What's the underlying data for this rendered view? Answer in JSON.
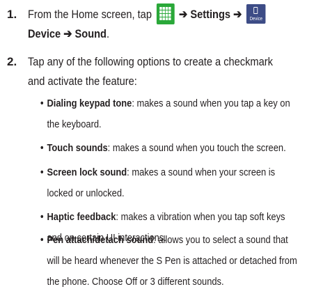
{
  "steps": [
    {
      "number": "1.",
      "pre": "From the Home screen, tap",
      "arrow1": " ➔ ",
      "settings": "Settings",
      "arrow2": " ➔ ",
      "device_icon_label": "Device",
      "line2": "Device ➔ Sound",
      "line2_end": "."
    },
    {
      "number": "2.",
      "line1": "Tap any of the following options to create a checkmark",
      "line2": "and activate the feature:"
    }
  ],
  "options": [
    {
      "term": "Dialing keypad tone",
      "desc_line1": ": makes a sound when you tap a key on",
      "desc_line2": "the keyboard."
    },
    {
      "term": "Touch sounds",
      "desc_line1": ": makes a sound when you touch the screen."
    },
    {
      "term": "Screen lock sound",
      "desc_line1": ": makes a sound when your screen is",
      "desc_line2": "locked or unlocked."
    },
    {
      "term": "Haptic feedback",
      "desc_line1": ": makes a vibration when you tap soft keys",
      "desc_line2": "and on certain UI interactions."
    },
    {
      "term": "Pen attach/detach sound",
      "desc_line1": ": allows you to select a sound that",
      "desc_line2": "will be heard whenever the S Pen is attached or detached from",
      "desc_line3": "the phone. Choose Off or 3 different sounds."
    }
  ],
  "bullet_char": "•",
  "icons": {
    "apps": "apps-grid-icon",
    "device": "device-icon",
    "apps_color": "#2aa839",
    "device_color": "#3d4c86"
  }
}
